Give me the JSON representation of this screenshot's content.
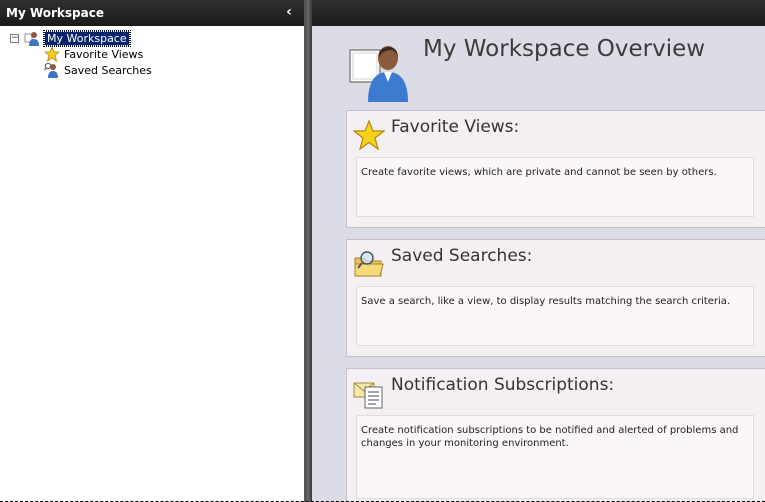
{
  "nav": {
    "title": "My Workspace",
    "collapse_icon": "chevron-left-icon",
    "tree": [
      {
        "label": "My Workspace",
        "icon": "workspace-user-icon",
        "expander": "⊟",
        "selected": true
      },
      {
        "label": "Favorite Views",
        "icon": "star-icon",
        "selected": false
      },
      {
        "label": "Saved Searches",
        "icon": "search-user-icon",
        "selected": false
      }
    ]
  },
  "overview": {
    "title": "My Workspace Overview",
    "icon": "workspace-user-icon"
  },
  "cards": [
    {
      "title": "Favorite Views:",
      "icon": "star-icon",
      "body": "Create favorite views, which are private and cannot be seen by others."
    },
    {
      "title": "Saved Searches:",
      "icon": "folder-search-icon",
      "body": "Save a search, like a view, to display results matching the search criteria."
    },
    {
      "title": "Notification Subscriptions:",
      "icon": "envelope-document-icon",
      "body": "Create notification subscriptions to be notified and alerted of problems and changes in your monitoring environment."
    }
  ],
  "colors": {
    "header_bg": "#1b1b1b",
    "content_bg": "#dcdce6",
    "card_bg": "#f4eff3",
    "selection": "#0a246a"
  }
}
